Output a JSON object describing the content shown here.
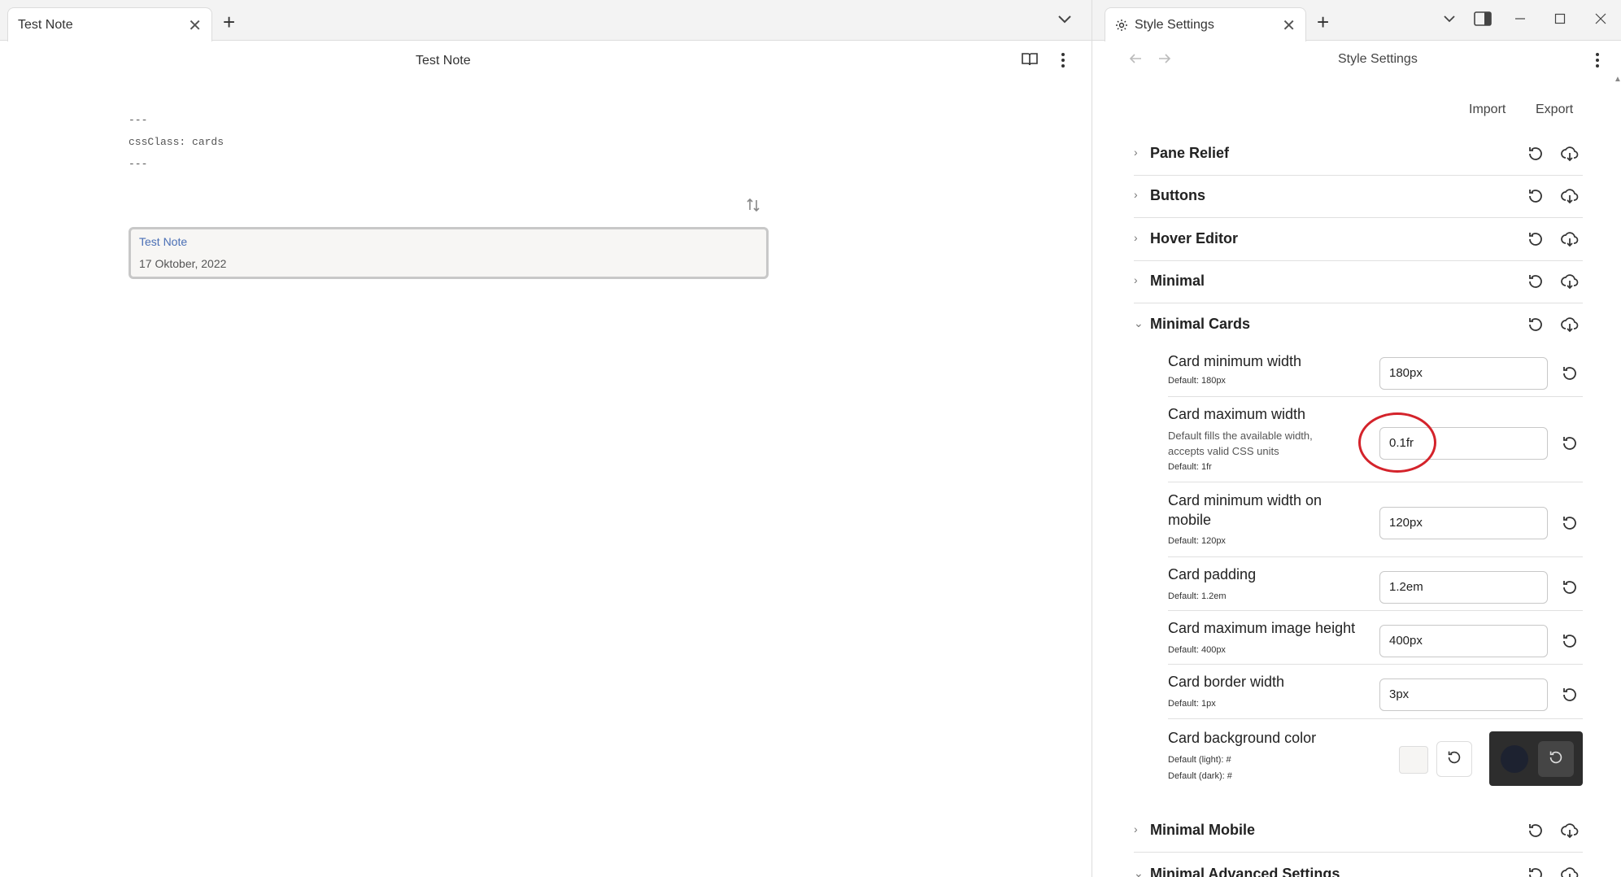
{
  "left_pane": {
    "tab_title": "Test Note",
    "view_title": "Test Note",
    "frontmatter": [
      "---",
      "cssClass: cards",
      "---"
    ],
    "card": {
      "title": "Test Note",
      "date": "17 Oktober, 2022"
    }
  },
  "right_pane": {
    "tab_title": "Style Settings",
    "view_title": "Style Settings",
    "import_label": "Import",
    "export_label": "Export",
    "sections": [
      {
        "label": "Pane Relief",
        "expanded": false
      },
      {
        "label": "Buttons",
        "expanded": false
      },
      {
        "label": "Hover Editor",
        "expanded": false
      },
      {
        "label": "Minimal",
        "expanded": false
      },
      {
        "label": "Minimal Cards",
        "expanded": true
      },
      {
        "label": "Minimal Mobile",
        "expanded": false
      },
      {
        "label": "Minimal Advanced Settings",
        "expanded": true
      }
    ],
    "settings": [
      {
        "name": "Card minimum width",
        "default": "Default: 180px",
        "value": "180px"
      },
      {
        "name": "Card maximum width",
        "description_1": "Default fills the available width,",
        "description_2": "accepts valid CSS units",
        "default": "Default: 1fr",
        "value": "0.1fr"
      },
      {
        "name_1": "Card minimum width on",
        "name_2": "mobile",
        "default": "Default: 120px",
        "value": "120px"
      },
      {
        "name": "Card padding",
        "default": "Default: 1.2em",
        "value": "1.2em"
      },
      {
        "name": "Card maximum image height",
        "default": "Default: 400px",
        "value": "400px"
      },
      {
        "name": "Card border width",
        "default": "Default: 1px",
        "value": "3px"
      },
      {
        "name": "Card background color",
        "default_light": "Default (light): #",
        "default_dark": "Default (dark): #"
      }
    ]
  },
  "colors": {
    "accent_link": "#4a6fb5",
    "highlight_ring": "#d4232b",
    "dark_box": "#2d2d2d",
    "light_swatch": "#f6f5f3"
  }
}
